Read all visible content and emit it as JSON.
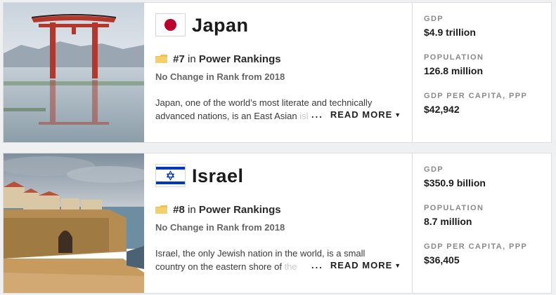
{
  "colors": {
    "accent": "#bc002d",
    "israel_blue": "#0038b8",
    "badge": "#f2c150"
  },
  "cards": [
    {
      "image": "torii-gate-in-water-photo",
      "flag": "japan-flag-icon",
      "country": "Japan",
      "rank": "#7",
      "rank_in": "in",
      "rank_list": "Power Rankings",
      "rank_change": "No Change in Rank from 2018",
      "description": "Japan, one of the world’s most literate and technically advanced nations, is an East Asian",
      "description_fade": " island",
      "read_more": "READ MORE",
      "stats": [
        {
          "label": "GDP",
          "value": "$4.9 trillion"
        },
        {
          "label": "Population",
          "value": "126.8 million"
        },
        {
          "label": "GDP per Capita, PPP",
          "value": "$42,942"
        }
      ]
    },
    {
      "image": "coastal-old-city-walls-photo",
      "flag": "israel-flag-icon",
      "country": "Israel",
      "rank": "#8",
      "rank_in": "in",
      "rank_list": "Power Rankings",
      "rank_change": "No Change in Rank from 2018",
      "description": "Israel, the only Jewish nation in the world, is a small country on the eastern shore of",
      "description_fade": " the",
      "read_more": "READ MORE",
      "stats": [
        {
          "label": "GDP",
          "value": "$350.9 billion"
        },
        {
          "label": "Population",
          "value": "8.7 million"
        },
        {
          "label": "GDP per Capita, PPP",
          "value": "$36,405"
        }
      ]
    }
  ]
}
